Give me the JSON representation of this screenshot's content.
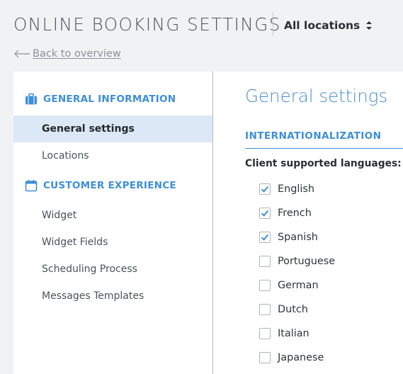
{
  "header": {
    "title": "ONLINE BOOKING SETTINGS",
    "location_selector": {
      "selected": "All locations",
      "icon": "up-down-chevron-icon"
    },
    "back_link": {
      "label": "Back to overview",
      "icon": "arrow-left-icon"
    }
  },
  "sidebar": {
    "sections": [
      {
        "title": "GENERAL INFORMATION",
        "icon": "briefcase-icon",
        "items": [
          {
            "label": "General settings",
            "active": true
          },
          {
            "label": "Locations",
            "active": false
          }
        ]
      },
      {
        "title": "CUSTOMER EXPERIENCE",
        "icon": "calendar-icon",
        "items": [
          {
            "label": "Widget",
            "active": false
          },
          {
            "label": "Widget Fields",
            "active": false
          },
          {
            "label": "Scheduling Process",
            "active": false
          },
          {
            "label": "Messages Templates",
            "active": false
          }
        ]
      }
    ]
  },
  "main": {
    "title": "General settings",
    "section": "INTERNATIONALIZATION",
    "languages_label": "Client supported languages:",
    "languages": [
      {
        "label": "English",
        "checked": true
      },
      {
        "label": "French",
        "checked": true
      },
      {
        "label": "Spanish",
        "checked": true
      },
      {
        "label": "Portuguese",
        "checked": false
      },
      {
        "label": "German",
        "checked": false
      },
      {
        "label": "Dutch",
        "checked": false
      },
      {
        "label": "Italian",
        "checked": false
      },
      {
        "label": "Japanese",
        "checked": false
      }
    ]
  },
  "colors": {
    "accent": "#3f8fd8",
    "active_item_bg": "#dde8f6",
    "page_bg": "#f1f2f3",
    "check": "#3f8fd8"
  }
}
